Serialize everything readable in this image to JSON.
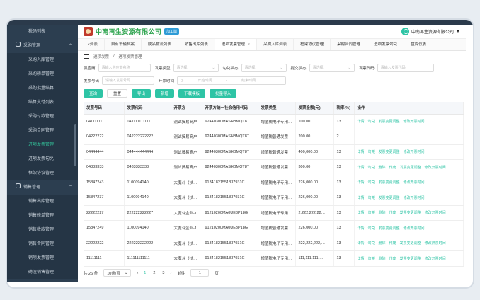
{
  "company": "中南再生资源有限公司",
  "company_badge": "加工端",
  "user_name": "中南再生资源有限公司",
  "sidebar": {
    "items": [
      {
        "label": "税码列表",
        "type": "item"
      },
      {
        "label": "采购管理",
        "type": "group"
      },
      {
        "label": "采购入库管理",
        "type": "sub"
      },
      {
        "label": "采购磅单管理",
        "type": "sub"
      },
      {
        "label": "采购批量结算",
        "type": "sub"
      },
      {
        "label": "结算支付列表",
        "type": "sub"
      },
      {
        "label": "采购付款管理",
        "type": "sub"
      },
      {
        "label": "采购合同管理",
        "type": "sub"
      },
      {
        "label": "进项发票管理",
        "type": "active"
      },
      {
        "label": "进项发票勾兑",
        "type": "sub"
      },
      {
        "label": "框架协议管理",
        "type": "sub"
      },
      {
        "label": "销售管理",
        "type": "group"
      },
      {
        "label": "销售出库管理",
        "type": "sub"
      },
      {
        "label": "销售磅单管理",
        "type": "sub"
      },
      {
        "label": "销售收款管理",
        "type": "sub"
      },
      {
        "label": "销售合同管理",
        "type": "sub"
      },
      {
        "label": "销项发票管理",
        "type": "sub"
      },
      {
        "label": "磅渣销售管理",
        "type": "sub"
      }
    ]
  },
  "tabs": [
    {
      "label": "‹列表"
    },
    {
      "label": "自有车辆档案"
    },
    {
      "label": "成品物流列表"
    },
    {
      "label": "销售出库列表"
    },
    {
      "label": "进项发票管理",
      "close": "×"
    },
    {
      "label": "采购入库列表"
    },
    {
      "label": "框架协议管理"
    },
    {
      "label": "采购合同管理"
    },
    {
      "label": "进项发票勾兑"
    },
    {
      "label": "盘库仪表"
    }
  ],
  "breadcrumb": {
    "root": "进项发票",
    "sep": "/",
    "current": "进项发票管理"
  },
  "filters": {
    "supplier_label": "供应商",
    "supplier_ph": "请输入供应商名称",
    "invtype_label": "发票类型",
    "invtype_ph": "请选择",
    "verify_label": "勾兑状态",
    "verify_ph": "请选择",
    "submit_label": "提交状态",
    "submit_ph": "请选择",
    "code_label": "发票代码",
    "code_ph": "请输入发票代码",
    "num_label": "发票号码",
    "num_ph": "请输入发票号码",
    "date_label": "开票时间",
    "date_start": "开始时间",
    "date_sep": "-",
    "date_end": "结束时间"
  },
  "buttons": {
    "query": "查询",
    "reset": "重置",
    "export": "导出",
    "add": "新增",
    "download": "下载模板",
    "import": "批量导入"
  },
  "table": {
    "headers": [
      "发票号码",
      "发票代码",
      "开票方",
      "开票方统一社会信用代码",
      "发票类型",
      "发票金额(元)",
      "税率(%)",
      "操作"
    ],
    "rows": [
      [
        "04111111",
        "041111111111",
        "测试贸易商户",
        "92440300MASHBMQT8T",
        "增值税电子专用…",
        "100.00",
        "13",
        "详情|勾兑|发票变更调整|修改开票时间"
      ],
      [
        "04222222",
        "042222222222",
        "测试贸易商户",
        "92440300MASHBMQT8T",
        "增值税普通发票",
        "200.00",
        "2",
        ""
      ],
      [
        "04444444",
        "044444444444",
        "测试贸易商户",
        "92440300MASHBMQT8T",
        "增值税普通发票",
        "400,000.00",
        "13",
        "详情|勾兑|发票变更调整|修改开票时间"
      ],
      [
        "04333333",
        "0433333333",
        "测试贸易商户",
        "92440300MASHBMQT8T",
        "增值税普通发票",
        "300.00",
        "13",
        "详情|勾兑|删除|作废|发票变更调整|修改开票时间"
      ],
      [
        "15847243",
        "1100094140",
        "大魔斗（扶…",
        "91341821551837931C",
        "增值税电子专用…",
        "226,000.00",
        "13",
        "详情|勾兑|发票变更调整|修改开票时间"
      ],
      [
        "15847237",
        "1100094140",
        "大魔斗（扶…",
        "91341821551837931C",
        "增值税电子专用…",
        "226,000.00",
        "13",
        "详情|勾兑|发票变更调整|修改开票时间"
      ],
      [
        "22222227",
        "222222222227",
        "大魔斗企业-1",
        "91210200MA0UE3P18G",
        "增值税电子专用…",
        "2,222,222,22…",
        "13",
        "详情|勾兑|删除|作废|发票变更调整|修改开票时间"
      ],
      [
        "15847249",
        "1100094140",
        "大魔斗企业-1",
        "91210200MA0UE3P18G",
        "增值税普通发票",
        "226,000.00",
        "13",
        "详情|勾兑|发票变更调整|修改开票时间"
      ],
      [
        "22222222",
        "222222222222",
        "大魔斗（扶…",
        "91341821551837931C",
        "增值税电子专用…",
        "222,222,222,…",
        "13",
        "详情|勾兑|删除|作废|发票变更调整|修改开票时间"
      ],
      [
        "11111111",
        "111111111111",
        "大魔斗（扶…",
        "91341821551837931C",
        "增值税电子专用…",
        "111,111,111,…",
        "13",
        "详情|勾兑|删除|作废|发票变更调整|修改开票时间"
      ]
    ]
  },
  "pager": {
    "total": "共 26 条",
    "size": "10条/页",
    "pages": [
      "1",
      "2",
      "3"
    ],
    "goto": "前往",
    "page_val": "1",
    "page_unit": "页"
  }
}
